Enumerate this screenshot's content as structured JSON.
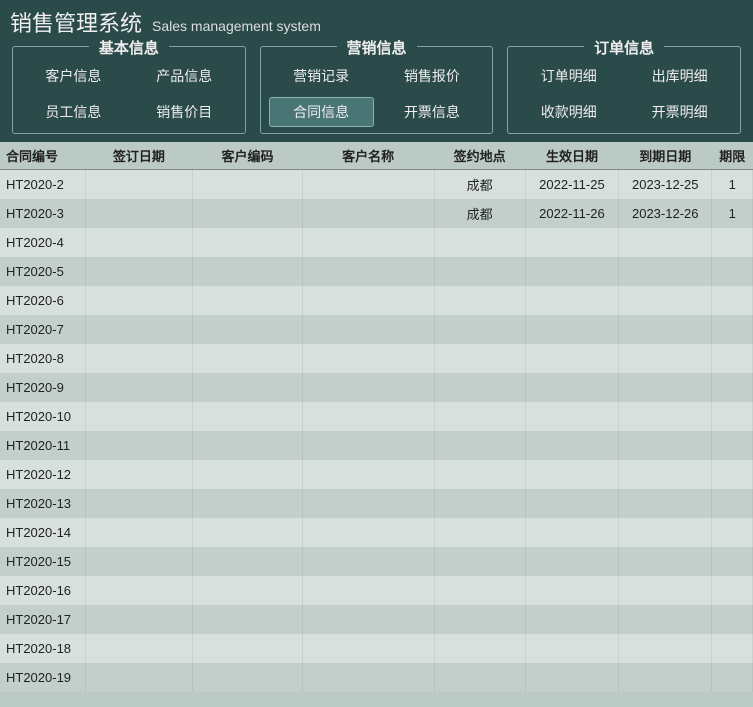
{
  "header": {
    "title_cn": "销售管理系统",
    "title_en": "Sales management system"
  },
  "nav": {
    "groups": [
      {
        "title": "基本信息",
        "rows": [
          [
            {
              "label": "客户信息"
            },
            {
              "label": "产品信息"
            }
          ],
          [
            {
              "label": "员工信息"
            },
            {
              "label": "销售价目"
            }
          ]
        ]
      },
      {
        "title": "营销信息",
        "rows": [
          [
            {
              "label": "营销记录"
            },
            {
              "label": "销售报价"
            }
          ],
          [
            {
              "label": "合同信息",
              "active": true
            },
            {
              "label": "开票信息"
            }
          ]
        ]
      },
      {
        "title": "订单信息",
        "rows": [
          [
            {
              "label": "订单明细"
            },
            {
              "label": "出库明细"
            }
          ],
          [
            {
              "label": "收款明细"
            },
            {
              "label": "开票明细"
            }
          ]
        ]
      }
    ]
  },
  "table": {
    "headers": [
      "合同编号",
      "签订日期",
      "客户编码",
      "客户名称",
      "签约地点",
      "生效日期",
      "到期日期",
      "期限"
    ],
    "rows": [
      {
        "id": "HT2020-2",
        "sign": "",
        "code": "",
        "name": "",
        "place": "成都",
        "eff": "2022-11-25",
        "exp": "2023-12-25",
        "term": "1"
      },
      {
        "id": "HT2020-3",
        "sign": "",
        "code": "",
        "name": "",
        "place": "成都",
        "eff": "2022-11-26",
        "exp": "2023-12-26",
        "term": "1"
      },
      {
        "id": "HT2020-4",
        "sign": "",
        "code": "",
        "name": "",
        "place": "",
        "eff": "",
        "exp": "",
        "term": ""
      },
      {
        "id": "HT2020-5",
        "sign": "",
        "code": "",
        "name": "",
        "place": "",
        "eff": "",
        "exp": "",
        "term": ""
      },
      {
        "id": "HT2020-6",
        "sign": "",
        "code": "",
        "name": "",
        "place": "",
        "eff": "",
        "exp": "",
        "term": ""
      },
      {
        "id": "HT2020-7",
        "sign": "",
        "code": "",
        "name": "",
        "place": "",
        "eff": "",
        "exp": "",
        "term": ""
      },
      {
        "id": "HT2020-8",
        "sign": "",
        "code": "",
        "name": "",
        "place": "",
        "eff": "",
        "exp": "",
        "term": ""
      },
      {
        "id": "HT2020-9",
        "sign": "",
        "code": "",
        "name": "",
        "place": "",
        "eff": "",
        "exp": "",
        "term": ""
      },
      {
        "id": "HT2020-10",
        "sign": "",
        "code": "",
        "name": "",
        "place": "",
        "eff": "",
        "exp": "",
        "term": ""
      },
      {
        "id": "HT2020-11",
        "sign": "",
        "code": "",
        "name": "",
        "place": "",
        "eff": "",
        "exp": "",
        "term": ""
      },
      {
        "id": "HT2020-12",
        "sign": "",
        "code": "",
        "name": "",
        "place": "",
        "eff": "",
        "exp": "",
        "term": ""
      },
      {
        "id": "HT2020-13",
        "sign": "",
        "code": "",
        "name": "",
        "place": "",
        "eff": "",
        "exp": "",
        "term": ""
      },
      {
        "id": "HT2020-14",
        "sign": "",
        "code": "",
        "name": "",
        "place": "",
        "eff": "",
        "exp": "",
        "term": ""
      },
      {
        "id": "HT2020-15",
        "sign": "",
        "code": "",
        "name": "",
        "place": "",
        "eff": "",
        "exp": "",
        "term": ""
      },
      {
        "id": "HT2020-16",
        "sign": "",
        "code": "",
        "name": "",
        "place": "",
        "eff": "",
        "exp": "",
        "term": ""
      },
      {
        "id": "HT2020-17",
        "sign": "",
        "code": "",
        "name": "",
        "place": "",
        "eff": "",
        "exp": "",
        "term": ""
      },
      {
        "id": "HT2020-18",
        "sign": "",
        "code": "",
        "name": "",
        "place": "",
        "eff": "",
        "exp": "",
        "term": ""
      },
      {
        "id": "HT2020-19",
        "sign": "",
        "code": "",
        "name": "",
        "place": "",
        "eff": "",
        "exp": "",
        "term": ""
      }
    ]
  }
}
